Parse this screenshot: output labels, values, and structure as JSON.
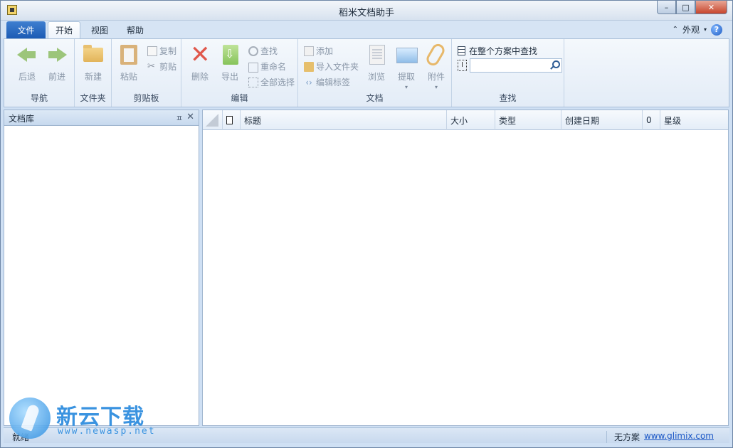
{
  "window": {
    "title": "稻米文档助手",
    "buttons": {
      "minimize": "–",
      "maximize": "□",
      "close": "✕"
    }
  },
  "ribbon": {
    "tabs": {
      "file": "文件",
      "home": "开始",
      "view": "视图",
      "help": "帮助"
    },
    "appearance_label": "外观",
    "help_glyph": "?",
    "groups": {
      "nav": {
        "label": "导航",
        "back": "后退",
        "forward": "前进"
      },
      "folder": {
        "label": "文件夹",
        "new": "新建"
      },
      "clipboard": {
        "label": "剪贴板",
        "paste": "粘贴",
        "copy": "复制",
        "cut": "剪贴"
      },
      "edit": {
        "label": "编辑",
        "delete": "删除",
        "export": "导出",
        "find": "查找",
        "rename": "重命名",
        "select_all": "全部选择"
      },
      "document": {
        "label": "文档",
        "add": "添加",
        "import_folder": "导入文件夹",
        "edit_tags": "编辑标签",
        "browse": "浏览",
        "extract": "提取",
        "attach": "附件"
      },
      "search": {
        "label": "查找",
        "scope": "在整个方案中查找",
        "cursor_glyph": "I",
        "query": ""
      }
    }
  },
  "left_panel": {
    "title": "文档库",
    "pin": "ㅍ",
    "close": "✕"
  },
  "grid": {
    "columns": {
      "title": "标题",
      "size": "大小",
      "type": "类型",
      "created": "创建日期",
      "attach": "0",
      "rating": "星级"
    }
  },
  "status": {
    "left": "就绪",
    "plan": "无方案",
    "link": "www.glimix.com"
  },
  "watermark": {
    "cn": "新云下载",
    "en": "www.newasp.net"
  }
}
